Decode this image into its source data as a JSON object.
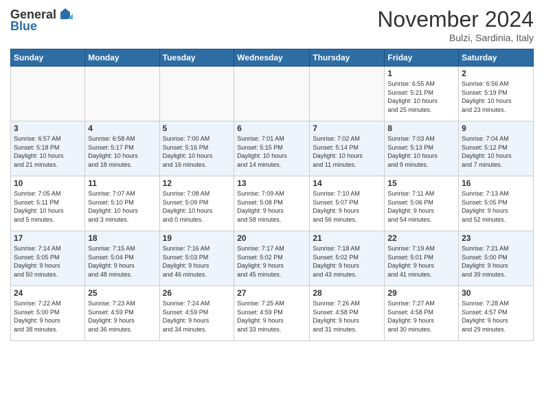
{
  "logo": {
    "general": "General",
    "blue": "Blue"
  },
  "header": {
    "title": "November 2024",
    "subtitle": "Bulzi, Sardinia, Italy"
  },
  "columns": [
    "Sunday",
    "Monday",
    "Tuesday",
    "Wednesday",
    "Thursday",
    "Friday",
    "Saturday"
  ],
  "weeks": [
    [
      {
        "day": "",
        "info": ""
      },
      {
        "day": "",
        "info": ""
      },
      {
        "day": "",
        "info": ""
      },
      {
        "day": "",
        "info": ""
      },
      {
        "day": "",
        "info": ""
      },
      {
        "day": "1",
        "info": "Sunrise: 6:55 AM\nSunset: 5:21 PM\nDaylight: 10 hours\nand 25 minutes."
      },
      {
        "day": "2",
        "info": "Sunrise: 6:56 AM\nSunset: 5:19 PM\nDaylight: 10 hours\nand 23 minutes."
      }
    ],
    [
      {
        "day": "3",
        "info": "Sunrise: 6:57 AM\nSunset: 5:18 PM\nDaylight: 10 hours\nand 21 minutes."
      },
      {
        "day": "4",
        "info": "Sunrise: 6:58 AM\nSunset: 5:17 PM\nDaylight: 10 hours\nand 18 minutes."
      },
      {
        "day": "5",
        "info": "Sunrise: 7:00 AM\nSunset: 5:16 PM\nDaylight: 10 hours\nand 16 minutes."
      },
      {
        "day": "6",
        "info": "Sunrise: 7:01 AM\nSunset: 5:15 PM\nDaylight: 10 hours\nand 14 minutes."
      },
      {
        "day": "7",
        "info": "Sunrise: 7:02 AM\nSunset: 5:14 PM\nDaylight: 10 hours\nand 11 minutes."
      },
      {
        "day": "8",
        "info": "Sunrise: 7:03 AM\nSunset: 5:13 PM\nDaylight: 10 hours\nand 9 minutes."
      },
      {
        "day": "9",
        "info": "Sunrise: 7:04 AM\nSunset: 5:12 PM\nDaylight: 10 hours\nand 7 minutes."
      }
    ],
    [
      {
        "day": "10",
        "info": "Sunrise: 7:05 AM\nSunset: 5:11 PM\nDaylight: 10 hours\nand 5 minutes."
      },
      {
        "day": "11",
        "info": "Sunrise: 7:07 AM\nSunset: 5:10 PM\nDaylight: 10 hours\nand 3 minutes."
      },
      {
        "day": "12",
        "info": "Sunrise: 7:08 AM\nSunset: 5:09 PM\nDaylight: 10 hours\nand 0 minutes."
      },
      {
        "day": "13",
        "info": "Sunrise: 7:09 AM\nSunset: 5:08 PM\nDaylight: 9 hours\nand 58 minutes."
      },
      {
        "day": "14",
        "info": "Sunrise: 7:10 AM\nSunset: 5:07 PM\nDaylight: 9 hours\nand 56 minutes."
      },
      {
        "day": "15",
        "info": "Sunrise: 7:11 AM\nSunset: 5:06 PM\nDaylight: 9 hours\nand 54 minutes."
      },
      {
        "day": "16",
        "info": "Sunrise: 7:13 AM\nSunset: 5:05 PM\nDaylight: 9 hours\nand 52 minutes."
      }
    ],
    [
      {
        "day": "17",
        "info": "Sunrise: 7:14 AM\nSunset: 5:05 PM\nDaylight: 9 hours\nand 50 minutes."
      },
      {
        "day": "18",
        "info": "Sunrise: 7:15 AM\nSunset: 5:04 PM\nDaylight: 9 hours\nand 48 minutes."
      },
      {
        "day": "19",
        "info": "Sunrise: 7:16 AM\nSunset: 5:03 PM\nDaylight: 9 hours\nand 46 minutes."
      },
      {
        "day": "20",
        "info": "Sunrise: 7:17 AM\nSunset: 5:02 PM\nDaylight: 9 hours\nand 45 minutes."
      },
      {
        "day": "21",
        "info": "Sunrise: 7:18 AM\nSunset: 5:02 PM\nDaylight: 9 hours\nand 43 minutes."
      },
      {
        "day": "22",
        "info": "Sunrise: 7:19 AM\nSunset: 5:01 PM\nDaylight: 9 hours\nand 41 minutes."
      },
      {
        "day": "23",
        "info": "Sunrise: 7:21 AM\nSunset: 5:00 PM\nDaylight: 9 hours\nand 39 minutes."
      }
    ],
    [
      {
        "day": "24",
        "info": "Sunrise: 7:22 AM\nSunset: 5:00 PM\nDaylight: 9 hours\nand 38 minutes."
      },
      {
        "day": "25",
        "info": "Sunrise: 7:23 AM\nSunset: 4:59 PM\nDaylight: 9 hours\nand 36 minutes."
      },
      {
        "day": "26",
        "info": "Sunrise: 7:24 AM\nSunset: 4:59 PM\nDaylight: 9 hours\nand 34 minutes."
      },
      {
        "day": "27",
        "info": "Sunrise: 7:25 AM\nSunset: 4:59 PM\nDaylight: 9 hours\nand 33 minutes."
      },
      {
        "day": "28",
        "info": "Sunrise: 7:26 AM\nSunset: 4:58 PM\nDaylight: 9 hours\nand 31 minutes."
      },
      {
        "day": "29",
        "info": "Sunrise: 7:27 AM\nSunset: 4:58 PM\nDaylight: 9 hours\nand 30 minutes."
      },
      {
        "day": "30",
        "info": "Sunrise: 7:28 AM\nSunset: 4:57 PM\nDaylight: 9 hours\nand 29 minutes."
      }
    ]
  ]
}
